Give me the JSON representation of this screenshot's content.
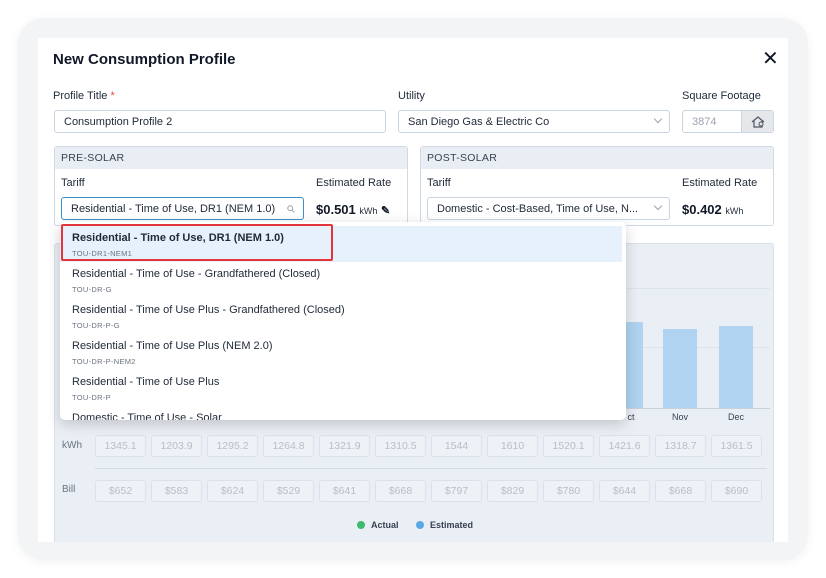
{
  "modal": {
    "title": "New Consumption Profile"
  },
  "profile": {
    "label": "Profile Title",
    "required_mark": "*",
    "value": "Consumption Profile 2"
  },
  "utility": {
    "label": "Utility",
    "value": "San Diego Gas & Electric Co"
  },
  "square_footage": {
    "label": "Square Footage",
    "value": "3874"
  },
  "pre_solar": {
    "heading": "PRE-SOLAR",
    "tariff_label": "Tariff",
    "tariff_value": "Residential - Time of Use, DR1 (NEM 1.0)",
    "rate_label": "Estimated Rate",
    "rate_value": "$0.501",
    "rate_unit": "kWh"
  },
  "post_solar": {
    "heading": "POST-SOLAR",
    "tariff_label": "Tariff",
    "tariff_value": "Domestic - Cost-Based, Time of Use, N...",
    "rate_label": "Estimated Rate",
    "rate_value": "$0.402",
    "rate_unit": "kWh"
  },
  "dropdown": {
    "options": [
      {
        "name": "Residential - Time of Use, DR1 (NEM 1.0)",
        "code": "TOU-DR1-NEM1",
        "selected": true
      },
      {
        "name": "Residential - Time of Use - Grandfathered (Closed)",
        "code": "TOU-DR-G"
      },
      {
        "name": "Residential - Time of Use Plus - Grandfathered (Closed)",
        "code": "TOU-DR-P-G"
      },
      {
        "name": "Residential - Time of Use Plus (NEM 2.0)",
        "code": "TOU-DR-P-NEM2"
      },
      {
        "name": "Residential - Time of Use Plus",
        "code": "TOU-DR-P"
      },
      {
        "name": "Domestic - Time of Use - Solar",
        "code": ""
      }
    ]
  },
  "chart": {
    "months_visible": [
      "ct",
      "Nov",
      "Dec"
    ]
  },
  "table": {
    "kwh_label": "kWh",
    "kwh": [
      "1345.1",
      "1203.9",
      "1295.2",
      "1264.8",
      "1321.9",
      "1310.5",
      "1544",
      "1610",
      "1520.1",
      "1421.6",
      "1318.7",
      "1361.5"
    ],
    "bill_label": "Bill",
    "bill": [
      "$652",
      "$583",
      "$624",
      "$529",
      "$641",
      "$668",
      "$797",
      "$829",
      "$780",
      "$644",
      "$668",
      "$690"
    ]
  },
  "legend": {
    "actual": "Actual",
    "estimated": "Estimated",
    "actual_color": "#3dba6f",
    "estimated_color": "#5aa9e6"
  }
}
